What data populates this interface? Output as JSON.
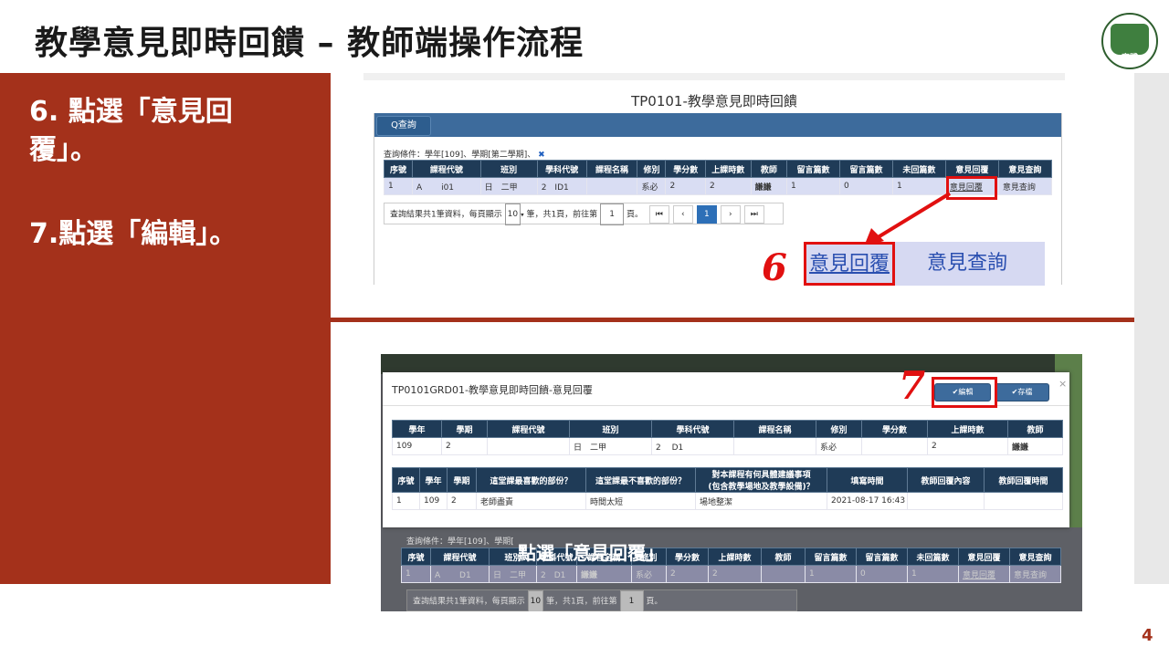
{
  "slide": {
    "title": "教學意見即時回饋 – 教師端操作流程",
    "page_number": "4",
    "logo_text": "實踐"
  },
  "steps": {
    "step6_line1": "6. 點選「意見回",
    "step6_line2": "覆」。",
    "step7": "7.點選「編輯」。"
  },
  "shot1": {
    "app_title": "TP0101-教學意見即時回饋",
    "query_button": "Q查詢",
    "conditions": "查詢條件：學年[109]、學期[第二學期]、",
    "clear_icon": "✖",
    "headers": [
      "序號",
      "課程代號",
      "班別",
      "學科代號",
      "課程名稱",
      "修別",
      "學分數",
      "上課時數",
      "教師",
      "留言篇數",
      "留言篇數",
      "未回篇數",
      "意見回覆",
      "意見查詢"
    ],
    "row": [
      "1",
      "A　　 i01",
      "日　二甲",
      "2　ID1",
      "",
      "系必",
      "2",
      "2",
      "謙謙",
      "1",
      "0",
      "1",
      "意見回覆",
      "意見查詢"
    ],
    "pager": {
      "text_before": "查詢結果共1筆資料，每頁顯示",
      "per_page": "10",
      "text_after": "筆，共1頁，前往第",
      "page_box": "1",
      "page_suffix": "頁。",
      "first": "⏮",
      "prev": "‹",
      "current": "1",
      "next": "›",
      "last": "⏭"
    },
    "zoom_reply": "意見回覆",
    "zoom_query": "意見查詢",
    "callout_number": "6"
  },
  "shot2": {
    "modal_title": "TP0101GRD01-教學意見即時回饋-意見回覆",
    "edit_button": "✔編輯",
    "save_button": "✔存檔",
    "close_icon": "×",
    "callout_number": "7",
    "table1_headers": [
      "學年",
      "學期",
      "課程代號",
      "班別",
      "學科代號",
      "課程名稱",
      "修別",
      "學分數",
      "上課時數",
      "教師"
    ],
    "table1_row": [
      "109",
      "2",
      "",
      "日　二甲",
      "2　 D1",
      "",
      "系必",
      "",
      "2",
      "謙謙"
    ],
    "table2_headers": [
      "序號",
      "學年",
      "學期",
      "這堂課最喜歡的部份？",
      "這堂課最不喜歡的部份？",
      "對本課程有何具體建議事項\n(包含教學場地及教學設備)？",
      "填寫時間",
      "教師回覆內容",
      "教師回覆時間"
    ],
    "table2_row": [
      "1",
      "109",
      "2",
      "老師盡責",
      "時間太短",
      "場地整潔",
      "2021-08-17 16:43",
      "",
      ""
    ],
    "bg_conditions": "查詢條件：學年[109]、學期[",
    "bg_row": [
      "1",
      "A　　 D1",
      "日　二甲",
      "2　D1",
      "謙謙",
      "系必",
      "2",
      "2",
      "",
      "1",
      "0",
      "1",
      "意見回覆",
      "意見查詢"
    ],
    "overlay_text": "點選「意見回覆」",
    "bg_pager": {
      "text_before": "查詢結果共1筆資料，每頁顯示",
      "per_page": "10",
      "text_after": "筆，共1頁，前往第",
      "page_box": "1",
      "page_suffix": "頁。"
    }
  },
  "colors": {
    "accent_red": "#a4311b",
    "callout_red": "#e11010",
    "table_header": "#1f3b57",
    "link_blue": "#2a4fb0"
  }
}
